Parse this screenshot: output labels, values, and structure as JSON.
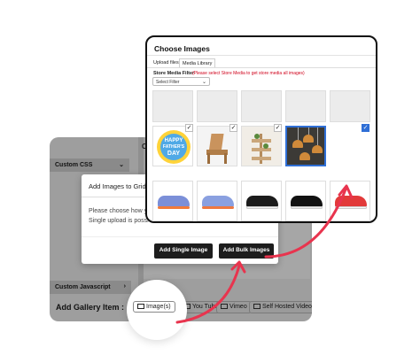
{
  "admin_panel": {
    "top_letter": "C",
    "custom_css_label": "Custom CSS",
    "custom_js_label": "Custom Javascript",
    "add_gallery_label": "Add Gallery Item :",
    "buttons": {
      "images": "Image(s)",
      "youtube": "You Tube",
      "vimeo": "Vimeo",
      "self_hosted": "Self Hosted Video"
    }
  },
  "modal": {
    "title": "Add Images to Grid",
    "text_line1": "Please choose how yo",
    "text_line2": "Single upload is possi",
    "single_button": "Add Single Image",
    "bulk_button": "Add Bulk Images"
  },
  "chooser": {
    "title": "Choose Images",
    "tabs": [
      "Upload files",
      "Media Library"
    ],
    "filter_label": "Store Media Filter",
    "filter_note": "(Please select Store Media to get store media all images)",
    "filter_value": "Select Filter",
    "row2": {
      "badge_line1": "HAPPY",
      "badge_line2": "FATHER'S",
      "badge_line3": "DAY"
    }
  },
  "colors": {
    "accent_blue": "#2f6fd6",
    "arrow_red": "#e8344e",
    "filter_note_red": "#d0021b",
    "panel_gray": "#9e9e9e"
  },
  "icons": [
    "chevron-down-icon",
    "image-icon",
    "video-icon",
    "checkmark-icon",
    "arrow-icon"
  ]
}
